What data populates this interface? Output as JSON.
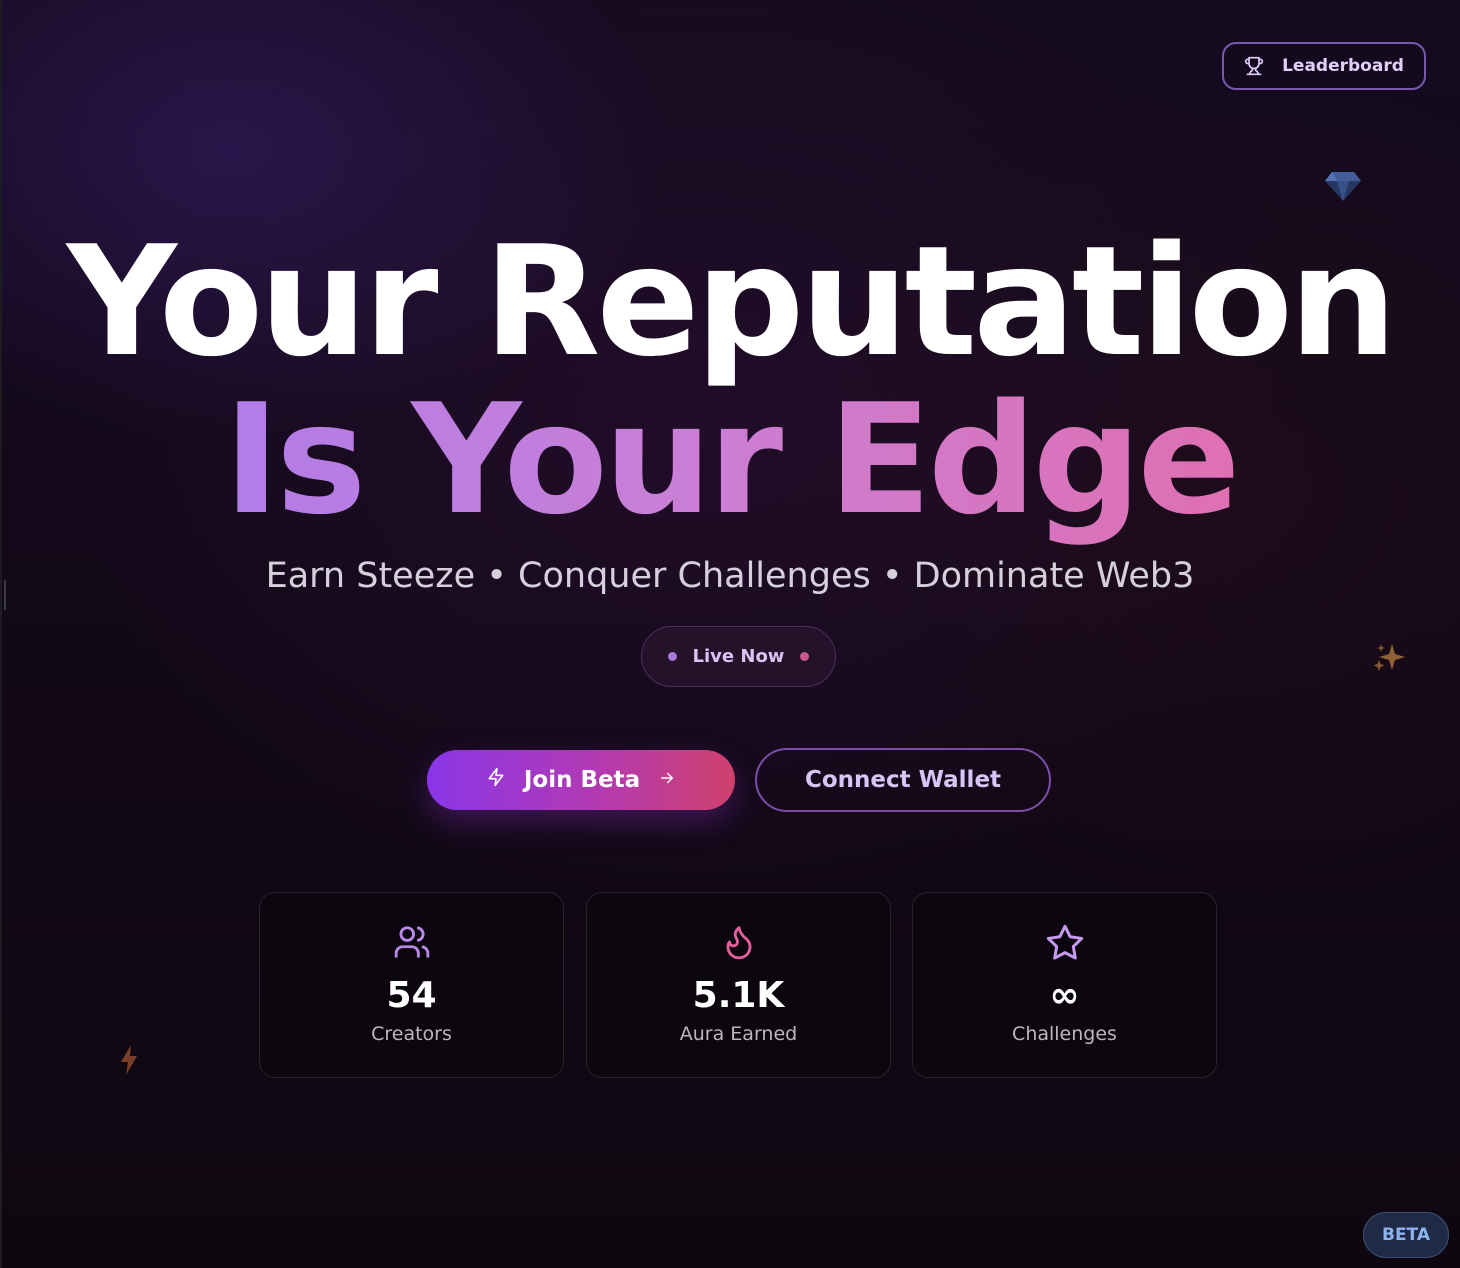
{
  "header": {
    "leaderboard_label": "Leaderboard",
    "leaderboard_icon": "trophy-icon"
  },
  "hero": {
    "line1": "Your Reputation",
    "line2": "Is Your Edge",
    "tagline": "Earn Steeze • Conquer Challenges • Dominate Web3",
    "live_label": "Live Now"
  },
  "actions": {
    "join_label": "Join Beta",
    "join_icons": [
      "lightning-icon",
      "arrow-right-icon"
    ],
    "connect_label": "Connect Wallet"
  },
  "stats": [
    {
      "icon": "users-icon",
      "value": "54",
      "label": "Creators"
    },
    {
      "icon": "flame-icon",
      "value": "5.1K",
      "label": "Aura Earned"
    },
    {
      "icon": "star-icon",
      "value": "∞",
      "label": "Challenges"
    }
  ],
  "decor": [
    "gem-icon",
    "sparkles-icon",
    "lightning-bolt-icon"
  ],
  "badge": {
    "label": "BETA"
  },
  "colors": {
    "accent_purple": "#8a36e8",
    "accent_pink": "#d0416d",
    "gradient_text_start": "#b27ce8",
    "gradient_text_end": "#df6fb2",
    "background": "#13091a",
    "beta_text": "#8db3f0"
  }
}
